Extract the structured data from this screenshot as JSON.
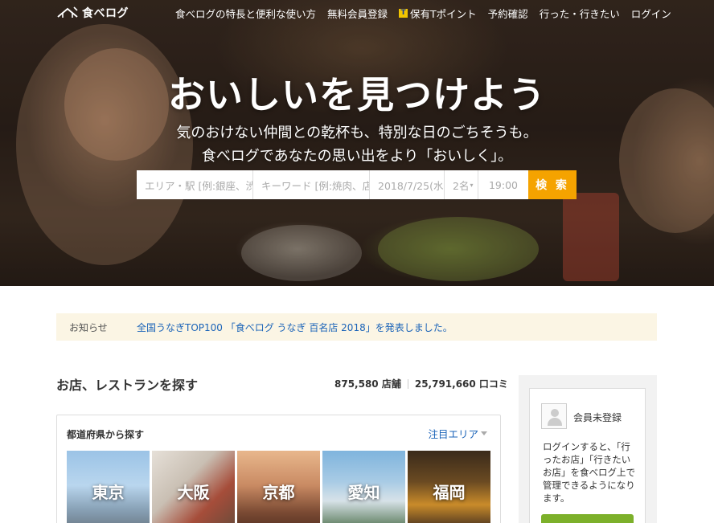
{
  "app": {
    "logo_text": "食べログ"
  },
  "nav": {
    "items": [
      {
        "label": "食べログの特長と便利な使い方"
      },
      {
        "label": "無料会員登録"
      },
      {
        "label": "保有Tポイント"
      },
      {
        "label": "予約確認"
      },
      {
        "label": "行った・行きたい"
      },
      {
        "label": "ログイン"
      }
    ]
  },
  "hero": {
    "headline": "おいしいを見つけよう",
    "sub1": "気のおけない仲間との乾杯も、特別な日のごちそうも。",
    "sub2": "食べログであなたの思い出をより「おいしく」。"
  },
  "search": {
    "area_placeholder": "エリア・駅 [例:銀座、渋",
    "keyword_placeholder": "キーワード [例:焼肉、店",
    "date": "2018/7/25(水",
    "people": "2名",
    "time": "19:00",
    "button_label": "検 索"
  },
  "notice": {
    "label": "お知らせ",
    "text": "全国うなぎTOP100 「食べログ うなぎ 百名店 2018」を発表しました。"
  },
  "main": {
    "title": "お店、レストランを探す",
    "stores": "875,580 店舗",
    "reviews": "25,791,660 口コミ"
  },
  "prefectures": {
    "title": "都道府県から探す",
    "attention": "注目エリア",
    "tiles": [
      {
        "label": "東京"
      },
      {
        "label": "大阪"
      },
      {
        "label": "京都"
      },
      {
        "label": "愛知"
      },
      {
        "label": "福岡"
      }
    ]
  },
  "sidebar": {
    "member_status": "会員未登録",
    "description": "ログインすると、「行ったお店」「行きたいお店」を食べログ上で管理できるようになります。"
  },
  "colors": {
    "accent": "#f5a300",
    "link": "#1a63b8",
    "notice_bg": "#fbf5e4",
    "login_button": "#7cb02a"
  }
}
